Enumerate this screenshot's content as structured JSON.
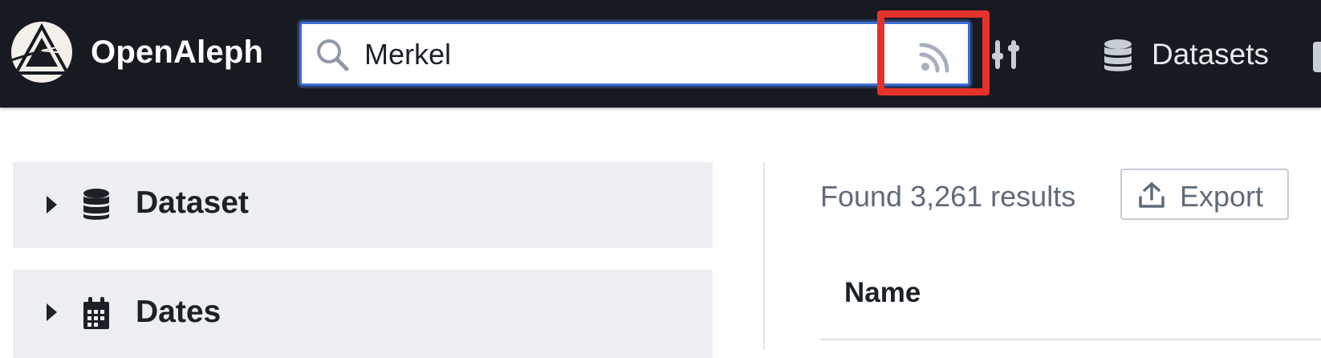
{
  "app": {
    "name": "OpenAleph"
  },
  "search": {
    "query": "Merkel",
    "placeholder": ""
  },
  "nav": {
    "datasets_label": "Datasets"
  },
  "facets": [
    {
      "label": "Dataset",
      "icon": "database-icon"
    },
    {
      "label": "Dates",
      "icon": "calendar-icon"
    }
  ],
  "results": {
    "count_text": "Found 3,261 results",
    "export_label": "Export"
  },
  "table": {
    "columns": [
      "Name"
    ]
  },
  "colors": {
    "navbar": "#171a20",
    "search_focus": "#3b6fd4",
    "highlight": "#e5322b",
    "facet_bg": "#eceef1",
    "muted_text": "#5f6b7c"
  }
}
